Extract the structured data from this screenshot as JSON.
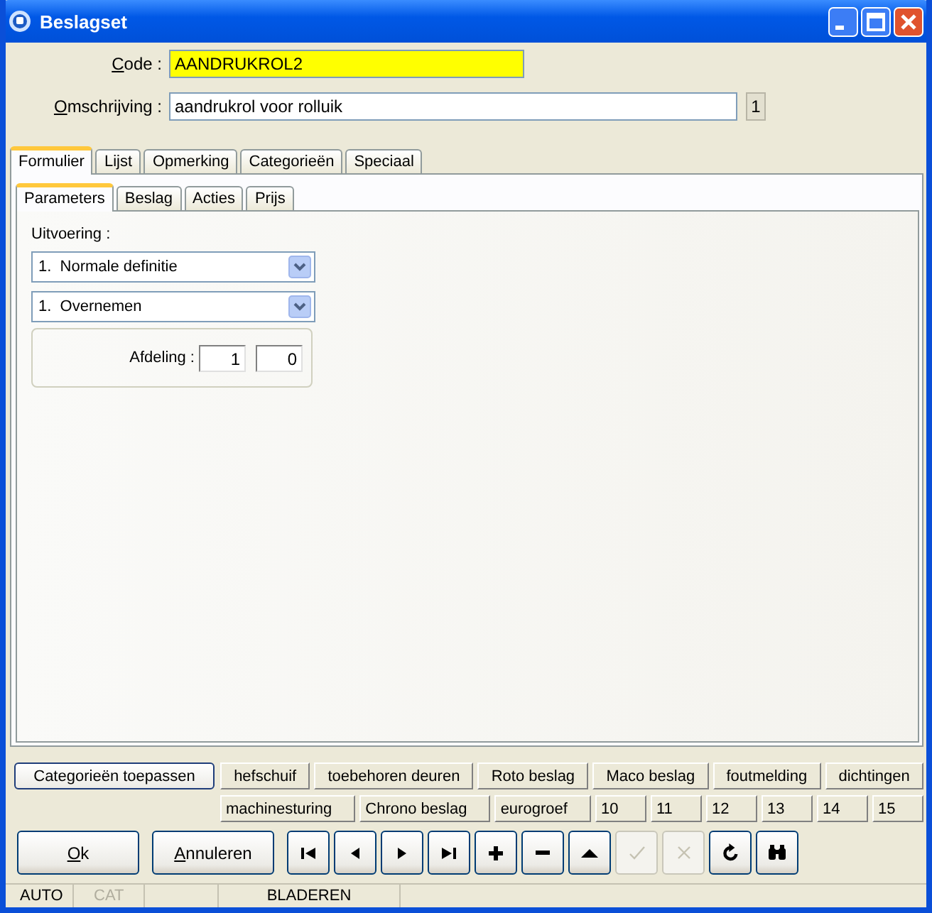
{
  "window": {
    "title": "Beslagset"
  },
  "fields": [
    {
      "label_accel": "C",
      "label_rest": "ode :",
      "value": "AANDRUKROL2",
      "kind": "highlight"
    },
    {
      "label_accel": "O",
      "label_rest": "mschrijving :",
      "value": "aandrukrol voor rolluik",
      "kind": "plain",
      "counter": "1"
    }
  ],
  "tabs": [
    {
      "label": "Formulier",
      "selected": true
    },
    {
      "label": "Lijst",
      "selected": false
    },
    {
      "label": "Opmerking",
      "selected": false
    },
    {
      "label": "Categorieën",
      "selected": false
    },
    {
      "label": "Speciaal",
      "selected": false
    }
  ],
  "subtabs": [
    {
      "label": "Parameters",
      "selected": true
    },
    {
      "label": "Beslag",
      "selected": false
    },
    {
      "label": "Acties",
      "selected": false
    },
    {
      "label": "Prijs",
      "selected": false
    }
  ],
  "uitvoering": {
    "label": "Uitvoering :",
    "dropdowns": [
      "1.  Normale definitie",
      "1.  Overnemen"
    ],
    "afdeling": {
      "label": "Afdeling :",
      "values": [
        "1",
        "0"
      ]
    }
  },
  "categories": {
    "apply": "Categorieën toepassen",
    "rows": [
      {
        "buttons": [
          "hefschuif",
          "toebehoren deuren",
          "Roto beslag",
          "Maco beslag",
          "foutmelding",
          "dichtingen"
        ]
      },
      {
        "buttons": [
          "machinesturing",
          "Chrono beslag",
          "eurogroef",
          "10",
          "11",
          "12",
          "13",
          "14",
          "15"
        ]
      }
    ]
  },
  "buttons": [
    {
      "accel": "O",
      "rest": "k"
    },
    {
      "accel": "A",
      "rest": "nnuleren"
    }
  ],
  "toolbar": [
    {
      "kind": "first",
      "disabled": false
    },
    {
      "kind": "prev",
      "disabled": false
    },
    {
      "kind": "next",
      "disabled": false
    },
    {
      "kind": "last",
      "disabled": false
    },
    {
      "kind": "add",
      "disabled": false
    },
    {
      "kind": "remove",
      "disabled": false
    },
    {
      "kind": "up",
      "disabled": false
    },
    {
      "kind": "confirm",
      "disabled": true
    },
    {
      "kind": "cancel",
      "disabled": true
    },
    {
      "kind": "refresh",
      "disabled": false
    },
    {
      "kind": "find",
      "disabled": false
    }
  ],
  "status_bar": [
    {
      "text": "AUTO",
      "disabled": false
    },
    {
      "text": "CAT",
      "disabled": true
    },
    {
      "text": "BLADEREN",
      "disabled": false
    }
  ]
}
